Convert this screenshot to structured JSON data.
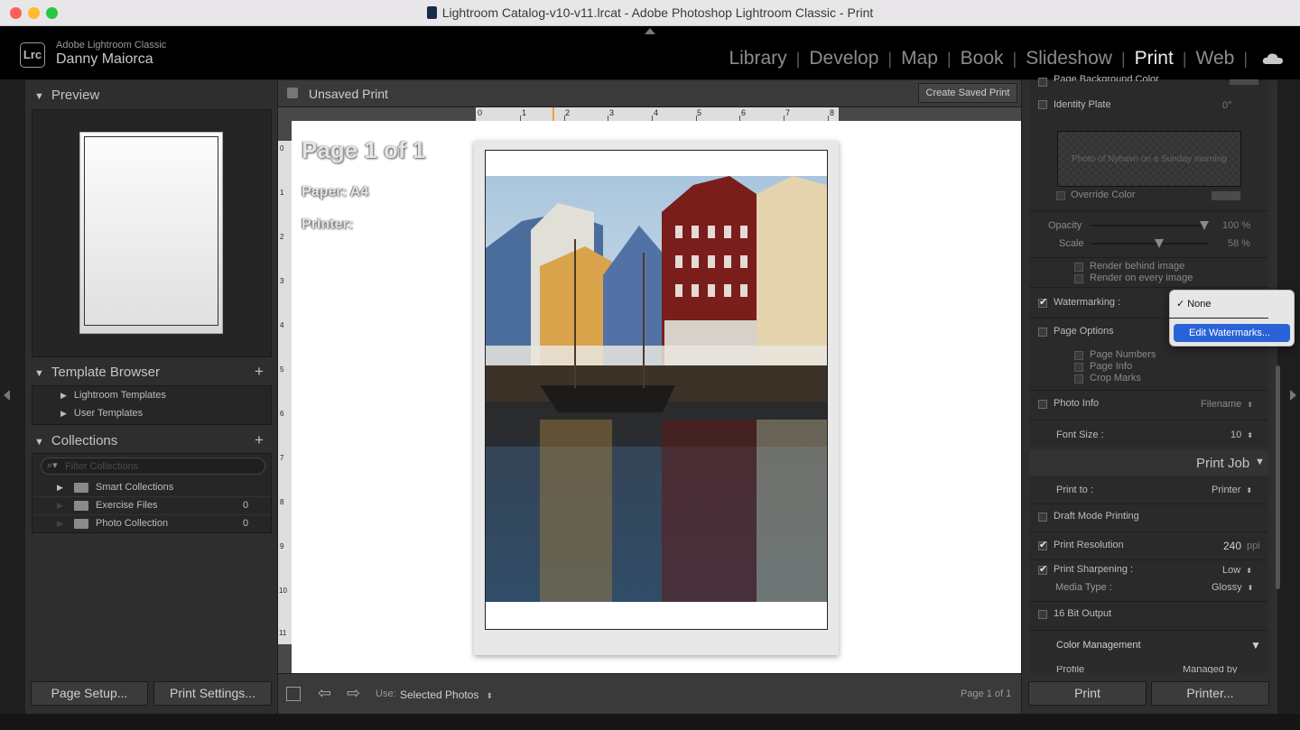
{
  "window": {
    "title": "Lightroom Catalog-v10-v11.lrcat - Adobe Photoshop Lightroom Classic - Print"
  },
  "header": {
    "badge": "Lrc",
    "app_name": "Adobe Lightroom Classic",
    "user_name": "Danny Maiorca",
    "modules": [
      "Library",
      "Develop",
      "Map",
      "Book",
      "Slideshow",
      "Print",
      "Web"
    ],
    "active_module": "Print"
  },
  "left": {
    "preview_title": "Preview",
    "template_browser_title": "Template Browser",
    "templates": [
      "Lightroom Templates",
      "User Templates"
    ],
    "collections_title": "Collections",
    "filter_placeholder": "Filter Collections",
    "collections": [
      {
        "name": "Smart Collections",
        "count": ""
      },
      {
        "name": "Exercise Files",
        "count": "0"
      },
      {
        "name": "Photo Collection",
        "count": "0"
      }
    ],
    "page_setup": "Page Setup...",
    "print_settings": "Print Settings..."
  },
  "center": {
    "title": "Unsaved Print",
    "create_saved": "Create Saved Print",
    "page_of": "Page 1 of 1",
    "paper": "Paper:  A4",
    "printer": "Printer:",
    "ruler_top": [
      "0",
      "1",
      "2",
      "3",
      "4",
      "5",
      "6",
      "7",
      "8"
    ],
    "ruler_left": [
      "0",
      "1",
      "2",
      "3",
      "4",
      "5",
      "6",
      "7",
      "8",
      "9",
      "10",
      "11"
    ],
    "use_label": "Use:",
    "use_value": "Selected Photos",
    "page_counter": "Page 1 of 1"
  },
  "right": {
    "page_bg_color": "Page Background Color",
    "identity_plate": "Identity Plate",
    "identity_angle": "0°",
    "identity_text": "Photo of Nyhavn on a Sunday morning",
    "override_color": "Override Color",
    "opacity_label": "Opacity",
    "opacity_value": "100 %",
    "opacity_level": 1.0,
    "scale_label": "Scale",
    "scale_value": "58 %",
    "scale_level": 0.58,
    "render_behind": "Render behind image",
    "render_every": "Render on every image",
    "watermarking": "Watermarking :",
    "watermark_menu": [
      "None",
      "Edit Watermarks..."
    ],
    "page_options": "Page Options",
    "page_numbers": "Page Numbers",
    "page_info": "Page Info",
    "crop_marks": "Crop Marks",
    "photo_info": "Photo Info",
    "photo_info_value": "Filename",
    "font_size_label": "Font Size :",
    "font_size_value": "10",
    "print_job": "Print Job",
    "print_to_label": "Print to :",
    "print_to_value": "Printer",
    "draft_mode": "Draft Mode Printing",
    "print_resolution": "Print Resolution",
    "resolution_value": "240",
    "resolution_unit": "ppi",
    "print_sharpening": "Print Sharpening :",
    "sharpening_value": "Low",
    "media_type_label": "Media Type :",
    "media_type_value": "Glossy",
    "bit_output": "16 Bit Output",
    "color_management": "Color Management",
    "profile_label": "Profile",
    "profile_value": "Managed by Printer",
    "print_btn": "Print",
    "printer_btn": "Printer..."
  }
}
